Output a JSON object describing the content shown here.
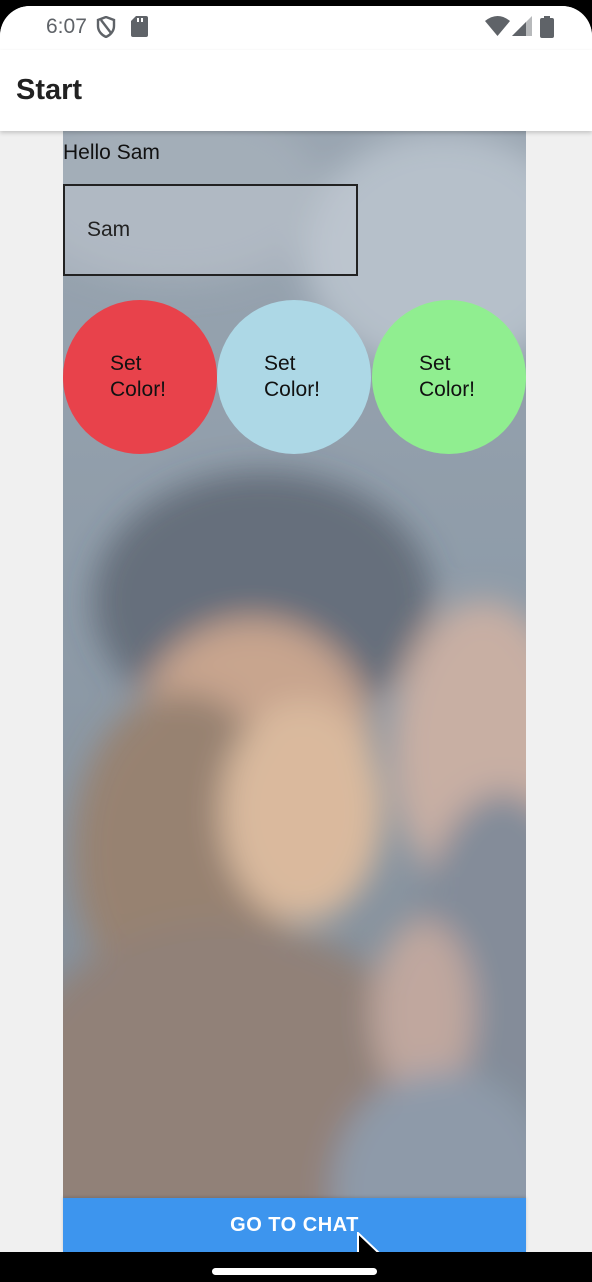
{
  "status_bar": {
    "time": "6:07",
    "left_icons": [
      "shield-icon",
      "sd-card-icon"
    ],
    "right_icons": [
      "wifi-icon",
      "cell-signal-icon",
      "battery-icon"
    ]
  },
  "app_bar": {
    "title": "Start"
  },
  "main": {
    "greeting": "Hello Sam",
    "name_input": {
      "value": "Sam"
    },
    "color_buttons": [
      {
        "label": "Set Color!",
        "color": "#e8424b"
      },
      {
        "label": "Set Color!",
        "color": "#add8e6"
      },
      {
        "label": "Set Color!",
        "color": "#90ee90"
      }
    ],
    "go_button": "GO TO CHAT"
  },
  "colors": {
    "accent": "#3d95ee",
    "background": "#f0f0f0"
  }
}
